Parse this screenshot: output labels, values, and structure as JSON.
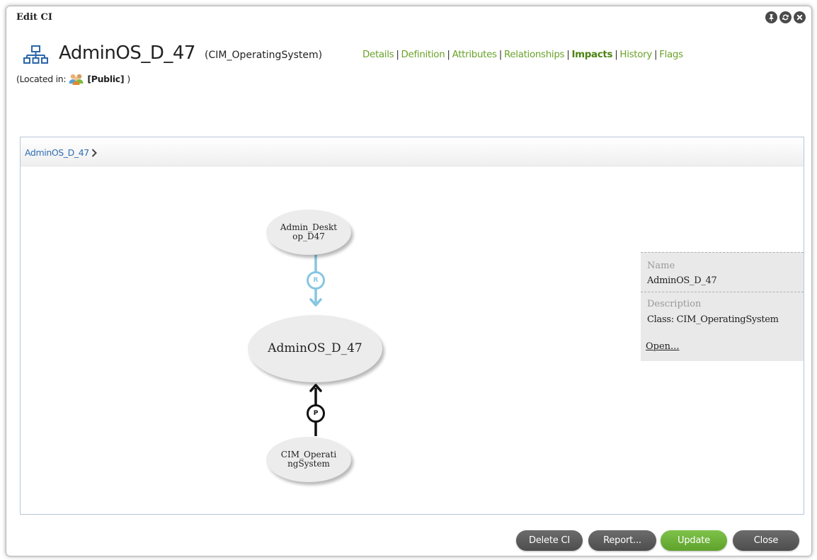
{
  "window": {
    "title": "Edit CI",
    "controls": [
      "pin-icon",
      "refresh-icon",
      "close-icon"
    ]
  },
  "header": {
    "ci_name": "AdminOS_D_47",
    "ci_class": "(CIM_OperatingSystem)",
    "tabs": [
      {
        "label": "Details",
        "active": false
      },
      {
        "label": "Definition",
        "active": false
      },
      {
        "label": "Attributes",
        "active": false
      },
      {
        "label": "Relationships",
        "active": false
      },
      {
        "label": "Impacts",
        "active": true
      },
      {
        "label": "History",
        "active": false
      },
      {
        "label": "Flags",
        "active": false
      }
    ],
    "located_prefix": "(Located in:",
    "located_value": "[Public]",
    "located_suffix": ")"
  },
  "impacts": {
    "breadcrumb": "AdminOS_D_47",
    "nodes": {
      "top": "Admin_Desktop_D47",
      "center": "AdminOS_D_47",
      "bottom": "CIM_OperatingSystem"
    },
    "edges": {
      "top_label": "R",
      "top_color": "#87c6e0",
      "bottom_label": "P",
      "bottom_color": "#111111"
    },
    "details": {
      "name_label": "Name",
      "name_value": "AdminOS_D_47",
      "description_label": "Description",
      "description_value": "Class: CIM_OperatingSystem",
      "open_link": "Open..."
    }
  },
  "footer": {
    "delete": "Delete CI",
    "report": "Report...",
    "update": "Update",
    "close": "Close"
  },
  "colors": {
    "tab_link": "#6aa22a",
    "tab_active": "#4c8412",
    "breadcrumb": "#2f6eb5",
    "update_button": "#6fb33a",
    "dark_button": "#5a5a5a"
  }
}
